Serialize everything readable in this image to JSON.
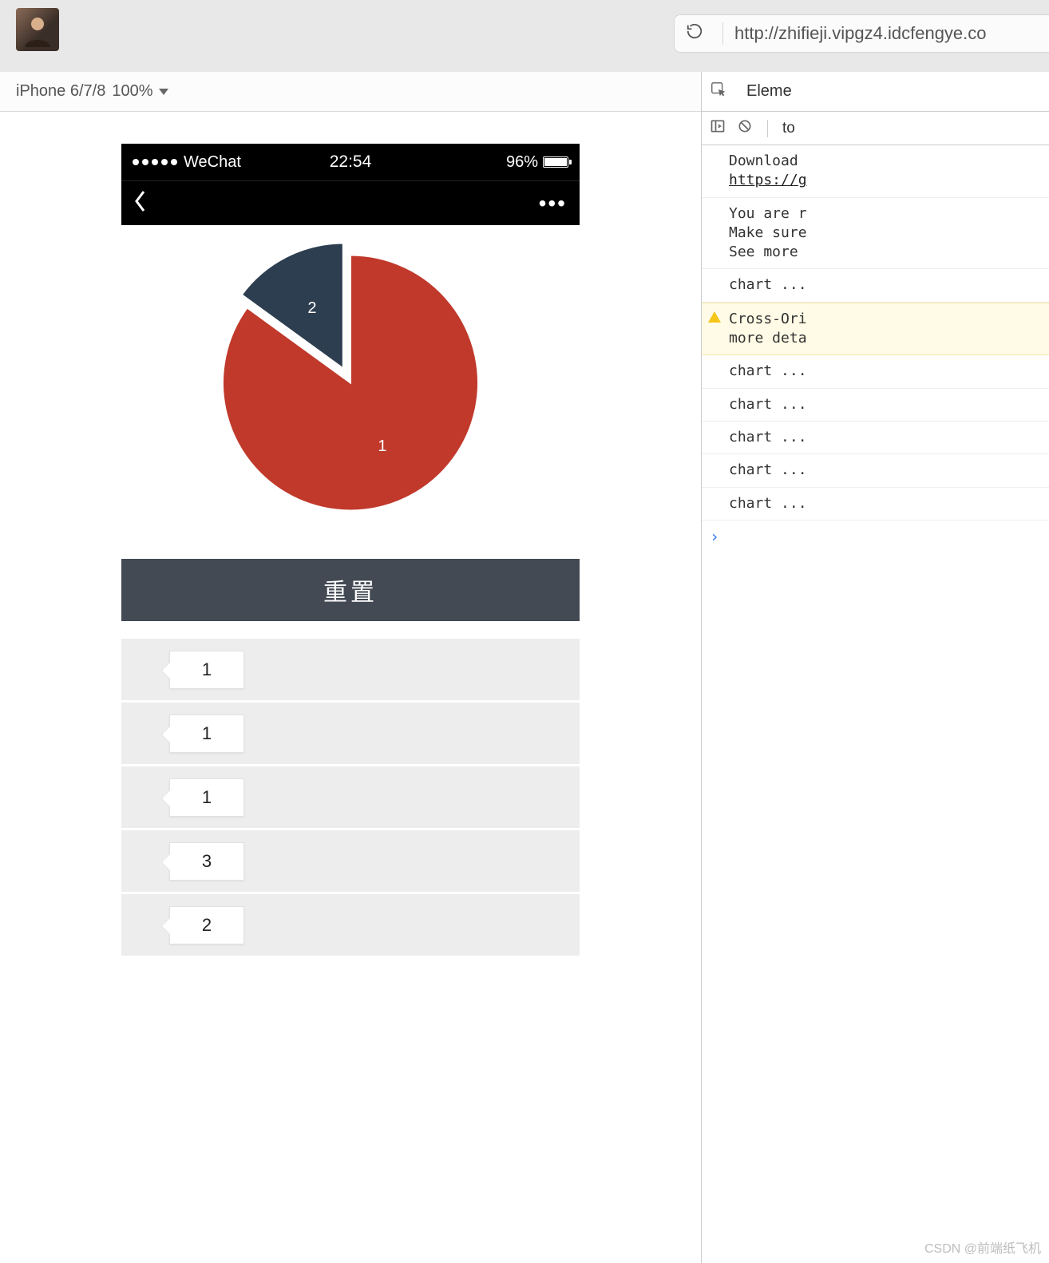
{
  "browser": {
    "url": "http://zhifieji.vipgz4.idcfengye.co"
  },
  "device_bar": {
    "device": "iPhone 6/7/8",
    "zoom": "100%"
  },
  "phone": {
    "status": {
      "carrier": "WeChat",
      "time": "22:54",
      "battery_pct": "96%"
    },
    "reset_label": "重置",
    "list": [
      "1",
      "1",
      "1",
      "3",
      "2"
    ]
  },
  "chart_data": {
    "type": "pie",
    "series": [
      {
        "name": "1",
        "value": 85,
        "color": "#c0392b",
        "label": "1"
      },
      {
        "name": "2",
        "value": 15,
        "color": "#2c3e50",
        "label": "2",
        "pulled": true
      }
    ]
  },
  "devtools": {
    "tabs": [
      "Eleme"
    ],
    "subtab": "to",
    "messages": [
      {
        "type": "info",
        "lines": [
          "Download ",
          "https://g"
        ],
        "link_index": 1
      },
      {
        "type": "info",
        "lines": [
          "You are r",
          "Make sure",
          "See more "
        ]
      },
      {
        "type": "info",
        "lines": [
          "chart ..."
        ]
      },
      {
        "type": "warn",
        "lines": [
          "Cross-Ori",
          "more deta"
        ]
      },
      {
        "type": "info",
        "lines": [
          "chart ..."
        ]
      },
      {
        "type": "info",
        "lines": [
          "chart ..."
        ]
      },
      {
        "type": "info",
        "lines": [
          "chart ..."
        ]
      },
      {
        "type": "info",
        "lines": [
          "chart ..."
        ]
      },
      {
        "type": "info",
        "lines": [
          "chart ..."
        ]
      }
    ],
    "prompt": "›"
  },
  "watermark": "CSDN @前端纸飞机"
}
